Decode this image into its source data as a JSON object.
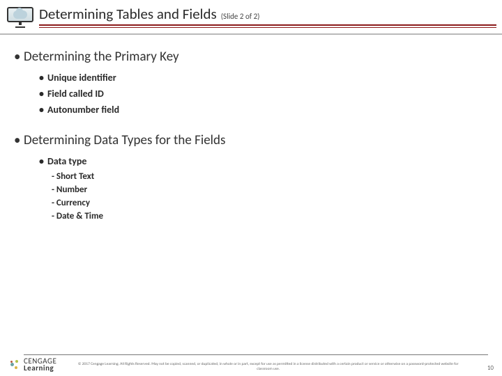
{
  "header": {
    "title": "Determining Tables and Fields",
    "sub": "(Slide 2 of 2)"
  },
  "section1": {
    "heading": "Determining the Primary Key",
    "items": [
      "Unique identifier",
      "Field called ID",
      "Autonumber field"
    ]
  },
  "section2": {
    "heading": "Determining Data Types for the Fields",
    "subheading": "Data type",
    "types": [
      "Short Text",
      "Number",
      "Currency",
      "Date & Time"
    ]
  },
  "footer": {
    "logo_line1": "CENGAGE",
    "logo_line2": "Learning",
    "copyright": "© 2017 Cengage Learning. All Rights Reserved. May not be copied, scanned, or duplicated, in whole or in part, except for use as permitted in a license distributed with a certain product or service or otherwise on a password-protected website for classroom use.",
    "page": "10"
  }
}
